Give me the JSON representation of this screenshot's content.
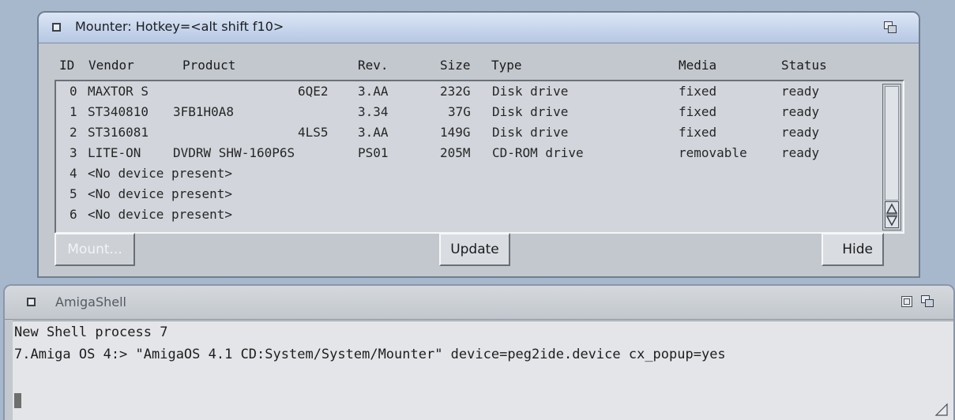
{
  "mounter": {
    "title": "Mounter: Hotkey=<alt shift f10>",
    "columns": {
      "id": "ID",
      "vendor": "Vendor",
      "product": "Product",
      "rev": "Rev.",
      "size": "Size",
      "type": "Type",
      "media": "Media",
      "status": "Status"
    },
    "rows": [
      {
        "id": "0",
        "vendor": "MAXTOR S",
        "product": "6QE2",
        "rev": "3.AA",
        "size": "232G",
        "type": "Disk drive",
        "media": "fixed",
        "status": "ready"
      },
      {
        "id": "1",
        "vendor": "ST340810",
        "product": "3FB1H0A8",
        "rev": "3.34",
        "size": "37G",
        "type": "Disk drive",
        "media": "fixed",
        "status": "ready"
      },
      {
        "id": "2",
        "vendor": "ST316081",
        "product": "4LS5",
        "rev": "3.AA",
        "size": "149G",
        "type": "Disk drive",
        "media": "fixed",
        "status": "ready"
      },
      {
        "id": "3",
        "vendor": "LITE-ON",
        "product": "DVDRW SHW-160P6S",
        "rev": "PS01",
        "size": "205M",
        "type": "CD-ROM drive",
        "media": "removable",
        "status": "ready"
      },
      {
        "id": "4",
        "vendor": "<No device present>",
        "product": "",
        "rev": "",
        "size": "",
        "type": "",
        "media": "",
        "status": ""
      },
      {
        "id": "5",
        "vendor": "<No device present>",
        "product": "",
        "rev": "",
        "size": "",
        "type": "",
        "media": "",
        "status": ""
      },
      {
        "id": "6",
        "vendor": "<No device present>",
        "product": "",
        "rev": "",
        "size": "",
        "type": "",
        "media": "",
        "status": ""
      }
    ],
    "buttons": {
      "mount": "Mount...",
      "update": "Update",
      "hide": "Hide"
    }
  },
  "shell": {
    "title": "AmigaShell",
    "lines": [
      "New Shell process 7",
      "7.Amiga OS 4:> \"AmigaOS 4.1 CD:System/System/Mounter\" device=peg2ide.device cx_popup=yes"
    ]
  },
  "icons": {
    "close": "close-gadget-icon",
    "depth": "depth-gadget-icon",
    "zoom": "zoom-gadget-icon",
    "resize": "resize-gadget-icon",
    "scroll": "scroll-arrows-icon"
  }
}
